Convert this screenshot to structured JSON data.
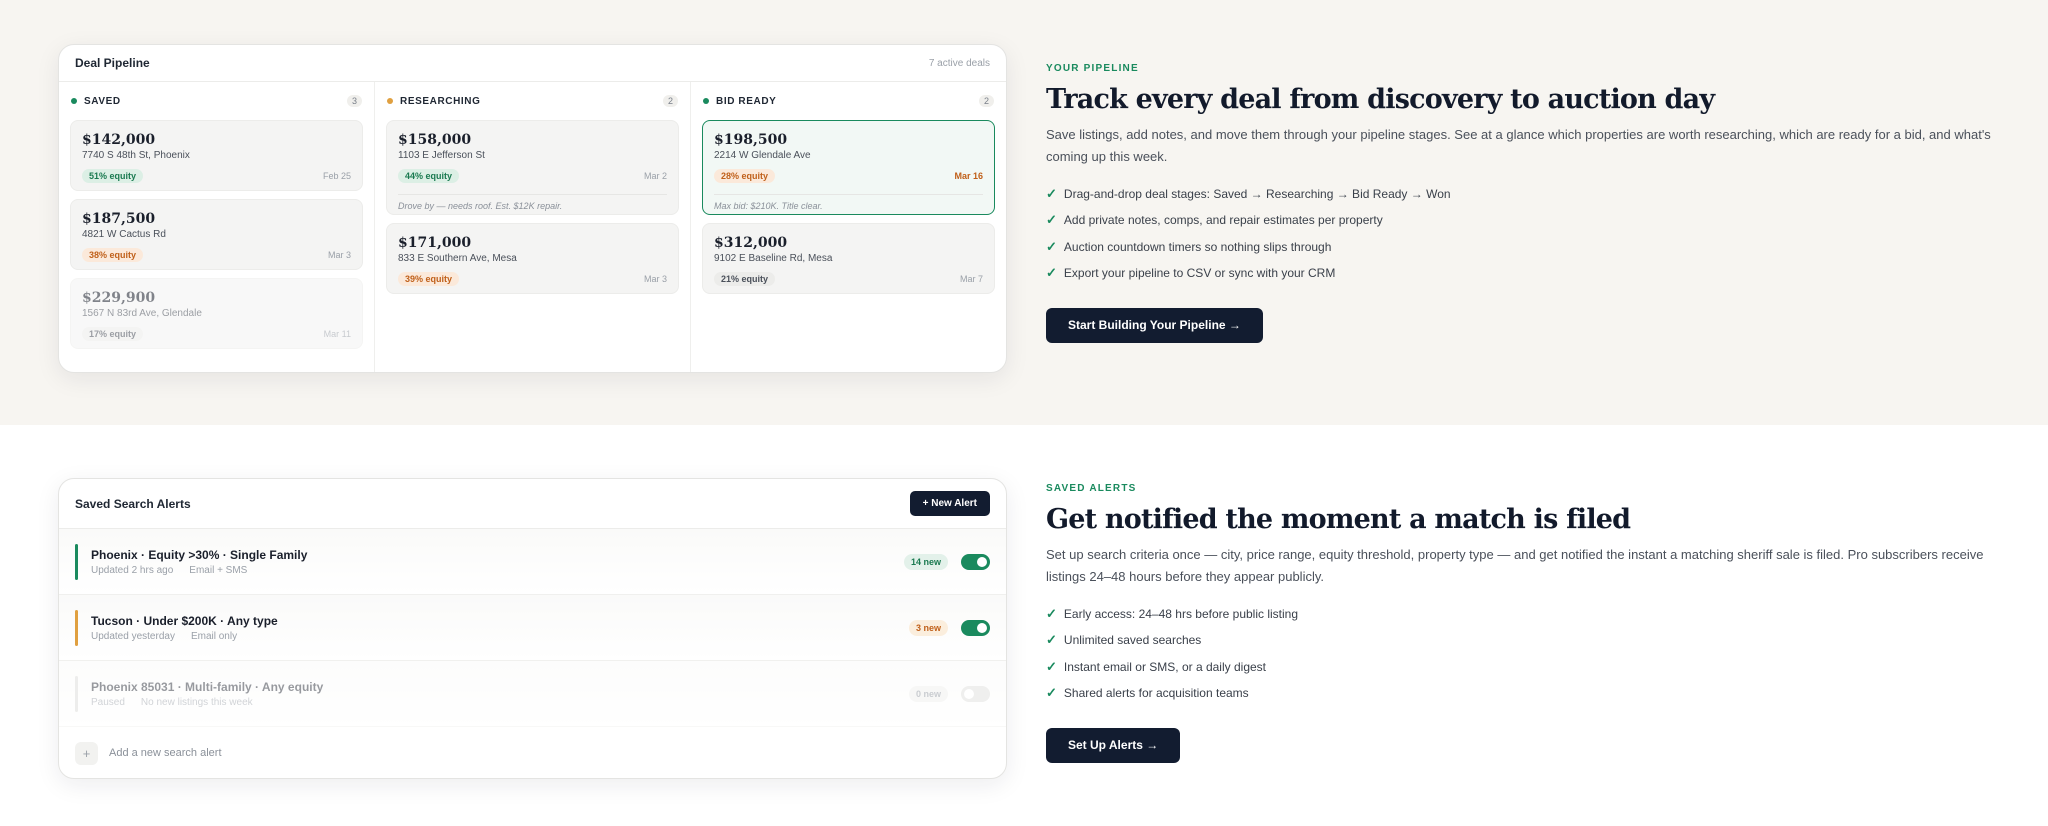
{
  "pipeline": {
    "card_title": "Deal Pipeline",
    "card_meta": "7 active deals",
    "columns": [
      {
        "name": "SAVED",
        "count": "3",
        "dot_color": "#1a8a5e",
        "deals": [
          {
            "price": "$142,000",
            "address": "7740 S 48th St, Phoenix",
            "equity": "51% equity",
            "date": "Feb 25"
          },
          {
            "price": "$187,500",
            "address": "4821 W Cactus Rd",
            "equity": "38% equity",
            "date": "Mar 3"
          },
          {
            "price": "$229,900",
            "address": "1567 N 83rd Ave, Glendale",
            "equity": "17% equity",
            "date": "Mar 11"
          }
        ]
      },
      {
        "name": "RESEARCHING",
        "count": "2",
        "dot_color": "#e0a040",
        "deals": [
          {
            "price": "$158,000",
            "address": "1103 E Jefferson St",
            "equity": "44% equity",
            "date": "Mar 2",
            "note": "Drove by — needs roof. Est. $12K repair."
          },
          {
            "price": "$171,000",
            "address": "833 E Southern Ave, Mesa",
            "equity": "39% equity",
            "date": "Mar 3"
          }
        ]
      },
      {
        "name": "BID READY",
        "count": "2",
        "dot_color": "#1a8a5e",
        "deals": [
          {
            "price": "$198,500",
            "address": "2214 W Glendale Ave",
            "equity": "28% equity",
            "date": "Mar 16",
            "note": "Max bid: $210K. Title clear."
          },
          {
            "price": "$312,000",
            "address": "9102 E Baseline Rd, Mesa",
            "equity": "21% equity",
            "date": "Mar 7"
          }
        ]
      }
    ]
  },
  "pipeline_text": {
    "eyebrow": "YOUR PIPELINE",
    "heading": "Track every deal from discovery to auction day",
    "description": "Save listings, add notes, and move them through your pipeline stages. See at a glance which properties are worth researching, which are ready for a bid, and what's coming up this week.",
    "features": [
      "Drag-and-drop deal stages: Saved → Researching → Bid Ready → Won",
      "Add private notes, comps, and repair estimates per property",
      "Auction countdown timers so nothing slips through",
      "Export your pipeline to CSV or sync with your CRM"
    ],
    "cta": "Start Building Your Pipeline →"
  },
  "alerts": {
    "card_title": "Saved Search Alerts",
    "new_alert_label": "+ New Alert",
    "items": [
      {
        "name": "Phoenix · Equity >30% · Single Family",
        "updated": "Updated 2 hrs ago",
        "channel": "Email + SMS",
        "badge": "14 new",
        "enabled": true,
        "bar_color": "#1a8a5e"
      },
      {
        "name": "Tucson · Under $200K · Any type",
        "updated": "Updated yesterday",
        "channel": "Email only",
        "badge": "3 new",
        "enabled": true,
        "bar_color": "#e0a040"
      },
      {
        "name": "Phoenix 85031 · Multi-family · Any equity",
        "updated": "Paused",
        "channel": "No new listings this week",
        "badge": "0 new",
        "enabled": false,
        "bar_color": "#d8d8d6"
      }
    ],
    "add_label": "Add a new search alert"
  },
  "alerts_text": {
    "eyebrow": "SAVED ALERTS",
    "heading": "Get notified the moment a match is filed",
    "description": "Set up search criteria once — city, price range, equity threshold, property type — and get notified the instant a matching sheriff sale is filed. Pro subscribers receive listings 24–48 hours before they appear publicly.",
    "features": [
      "Early access: 24–48 hrs before public listing",
      "Unlimited saved searches",
      "Instant email or SMS, or a daily digest",
      "Shared alerts for acquisition teams"
    ],
    "cta": "Set Up Alerts →"
  },
  "colors": {
    "accent": "#1a8a5e",
    "navy": "#121c30",
    "amber": "#e0a040"
  }
}
